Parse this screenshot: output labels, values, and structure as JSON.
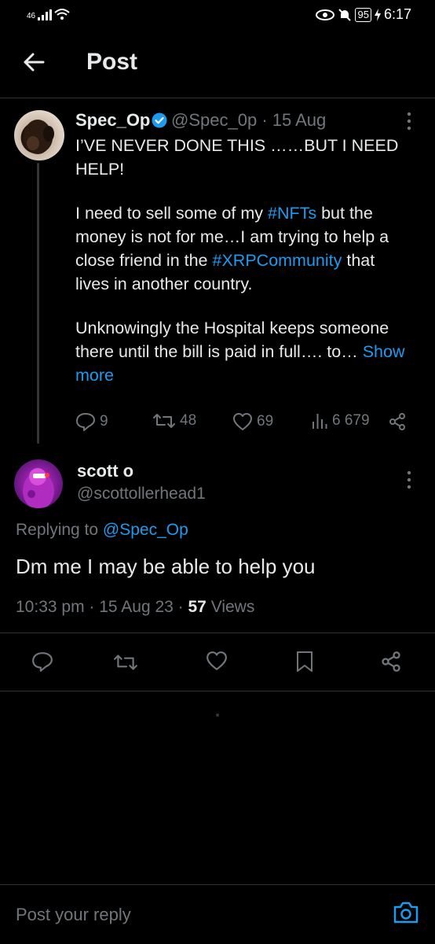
{
  "status_bar": {
    "signal": "46",
    "battery": "95",
    "time": "6:17"
  },
  "header": {
    "title": "Post"
  },
  "post": {
    "author_name": "Spec_Op",
    "handle": "@Spec_0p",
    "date": "15 Aug",
    "paragraph1": "I’VE NEVER DONE THIS ……BUT I NEED HELP!",
    "p2_a": "I need to sell some of my ",
    "p2_tag1": "#NFTs",
    "p2_b": " but the money is not for me…I am trying to help a close friend in the ",
    "p2_tag2": "#XRPCommunity",
    "p2_c": " that lives in another country.",
    "p3": "Unknowingly the Hospital keeps someone there until the bill is paid in full…. to…",
    "show_more": "Show more",
    "replies": "9",
    "reposts": "48",
    "likes": "69",
    "views": "6 679"
  },
  "reply": {
    "author_name": "scott o",
    "handle": "@scottollerhead1",
    "replying_label": "Replying to",
    "replying_to": "@Spec_Op",
    "text": "Dm me I may be able to help you",
    "time": "10:33 pm",
    "date": "15 Aug 23",
    "views_count": "57",
    "views_label": "Views"
  },
  "composer": {
    "placeholder": "Post your reply"
  },
  "icons": [
    "back-arrow-icon",
    "verified-icon",
    "more-icon",
    "reply-icon",
    "repost-icon",
    "like-icon",
    "views-icon",
    "share-icon",
    "bookmark-icon",
    "camera-icon"
  ],
  "colors": {
    "background": "#000000",
    "accent": "#1d9bf0",
    "muted": "#71767b",
    "text": "#e7e9ea"
  }
}
